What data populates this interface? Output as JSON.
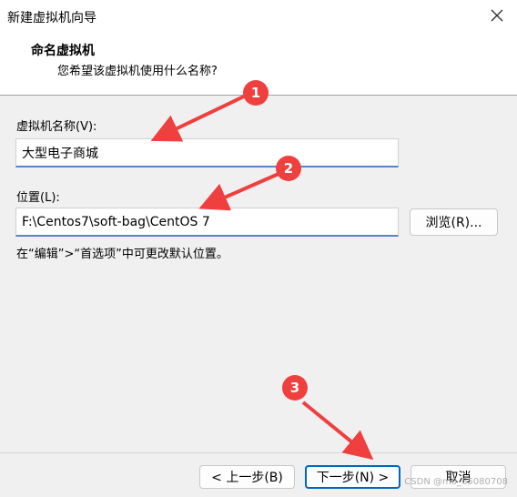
{
  "window": {
    "title": "新建虚拟机向导"
  },
  "header": {
    "title": "命名虚拟机",
    "subtitle": "您希望该虚拟机使用什么名称?"
  },
  "name_field": {
    "label": "虚拟机名称(V):",
    "value": "大型电子商城"
  },
  "location_field": {
    "label": "位置(L):",
    "value": "F:\\Centos7\\soft-bag\\CentOS 7"
  },
  "browse_button": "浏览(R)...",
  "hint": "在“编辑”>“首选项”中可更改默认位置。",
  "buttons": {
    "back": "< 上一步(B)",
    "next": "下一步(N) >",
    "cancel": "取消"
  },
  "annotations": [
    "1",
    "2",
    "3"
  ],
  "watermark": "CSDN @m0_65080708",
  "colors": {
    "annotation": "#ef3f3f",
    "primary_border": "#0067c0"
  }
}
